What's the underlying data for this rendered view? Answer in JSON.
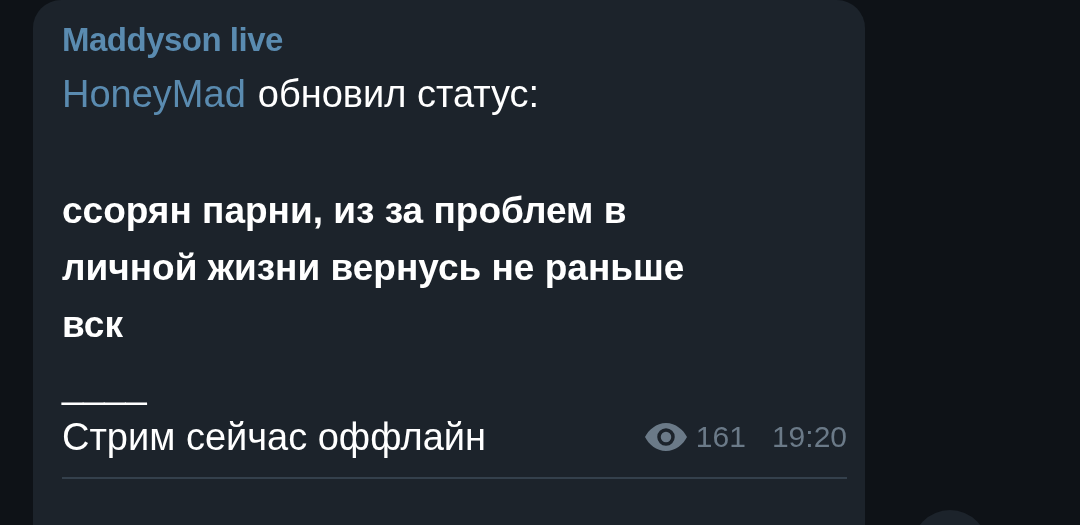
{
  "channel_name": "Maddyson live",
  "status_update": {
    "author": "HoneyMad",
    "text": "обновил статус:"
  },
  "message_lines": [
    "ссорян парни, из за проблем в",
    "личной жизни вернусь не раньше",
    "вск"
  ],
  "separator": "____",
  "footer_text": "Стрим сейчас оффлайн",
  "views": "161",
  "time": "19:20"
}
